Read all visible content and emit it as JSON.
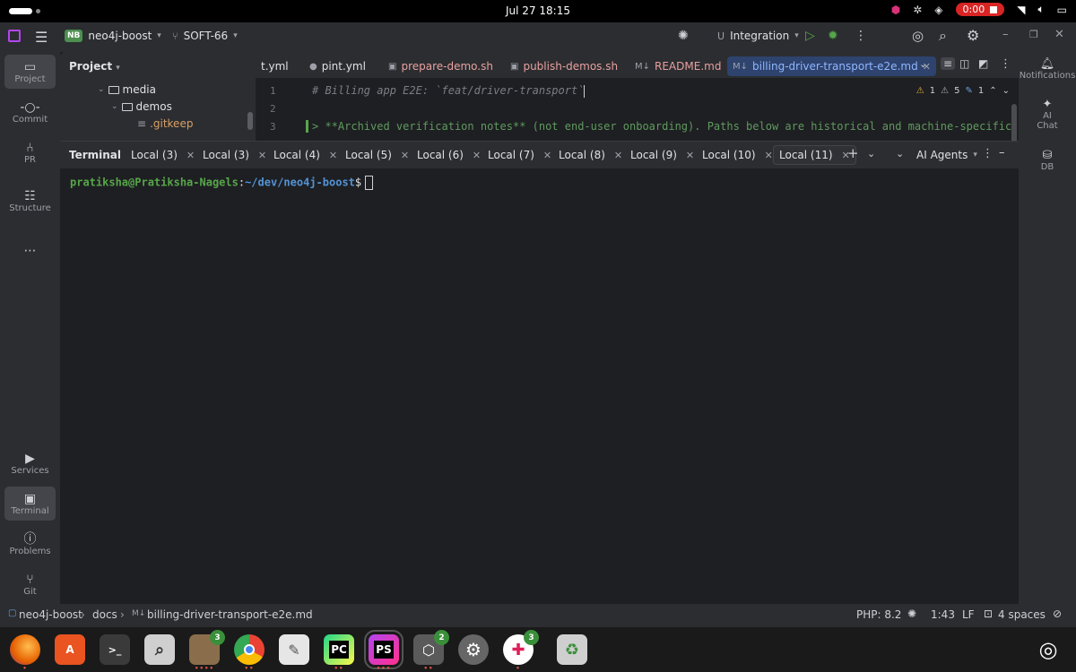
{
  "system": {
    "clock": "Jul 27  18:15",
    "recording": "0:00"
  },
  "toolbar": {
    "project_badge": "NB",
    "project_name": "neo4j-boost",
    "branch": "SOFT-66",
    "run_config": "Integration"
  },
  "left_strip": [
    {
      "label": "Project",
      "icon": "folder-icon"
    },
    {
      "label": "Commit",
      "icon": "commit-icon"
    },
    {
      "label": "PR",
      "icon": "pull-request-icon"
    },
    {
      "label": "Structure",
      "icon": "structure-icon"
    },
    {
      "label": "Services",
      "icon": "services-icon"
    },
    {
      "label": "Terminal",
      "icon": "terminal-icon"
    },
    {
      "label": "Problems",
      "icon": "problems-icon"
    },
    {
      "label": "Git",
      "icon": "git-icon"
    }
  ],
  "right_strip": [
    {
      "label": "Notifications",
      "icon": "bell-icon"
    },
    {
      "label": "AI Chat",
      "icon": "ai-chat-icon"
    },
    {
      "label": "DB",
      "icon": "database-icon"
    }
  ],
  "project_panel": {
    "title": "Project",
    "tree": [
      {
        "label": "media",
        "type": "folder"
      },
      {
        "label": "demos",
        "type": "folder"
      },
      {
        "label": ".gitkeep",
        "type": "file"
      }
    ]
  },
  "editor": {
    "tabs": [
      {
        "label": "t.yml",
        "icon": ""
      },
      {
        "label": "pint.yml",
        "icon": "github-icon"
      },
      {
        "label": "prepare-demo.sh",
        "icon": "shell-icon"
      },
      {
        "label": "publish-demos.sh",
        "icon": "shell-icon"
      },
      {
        "label": "README.md",
        "icon": "markdown-icon"
      },
      {
        "label": "billing-driver-transport-e2e.md",
        "icon": "markdown-icon"
      }
    ],
    "line_numbers": [
      "1",
      "2",
      "3"
    ],
    "lines": [
      "# Billing app E2E: `feat/driver-transport`",
      "",
      "> **Archived verification notes** (not end-user onboarding). Paths below are historical and machine-specific. Pr"
    ],
    "inspections": {
      "warnings": "1",
      "weak_warnings": "5",
      "typos": "1"
    }
  },
  "terminal": {
    "title": "Terminal",
    "tabs": [
      "Local (3)",
      "Local (3)",
      "Local (4)",
      "Local (5)",
      "Local (6)",
      "Local (7)",
      "Local (8)",
      "Local (9)",
      "Local (10)",
      "Local (11)"
    ],
    "ai_agents": "AI Agents",
    "prompt_user": "pratiksha@Pratiksha-Nagels",
    "prompt_sep": ":",
    "prompt_path": "~/dev/neo4j-boost",
    "prompt_symbol": "$"
  },
  "statusbar": {
    "breadcrumb": [
      "neo4j-boost",
      "docs",
      "billing-driver-transport-e2e.md"
    ],
    "php": "PHP: 8.2",
    "position": "1:43",
    "line_sep": "LF",
    "indent": "4 spaces"
  },
  "dock": [
    {
      "name": "firefox",
      "label": "",
      "color": "#e66000"
    },
    {
      "name": "app-center",
      "label": "",
      "color": "#e95420"
    },
    {
      "name": "terminal",
      "label": ">_",
      "color": "#3a3a3a"
    },
    {
      "name": "image-viewer",
      "label": "",
      "color": "#cfcfcf"
    },
    {
      "name": "files",
      "label": "",
      "color": "#8a6e4b",
      "count": "3"
    },
    {
      "name": "chrome",
      "label": "",
      "color": "#4285f4"
    },
    {
      "name": "text-editor",
      "label": "",
      "color": "#e6e6e6"
    },
    {
      "name": "pycharm",
      "label": "PC",
      "color": "#21d789"
    },
    {
      "name": "phpstorm",
      "label": "PS",
      "color": "#b345f1"
    },
    {
      "name": "virtualbox",
      "label": "",
      "color": "#5a5a5a",
      "count": "2"
    },
    {
      "name": "settings",
      "label": "",
      "color": "#666666"
    },
    {
      "name": "slack",
      "label": "",
      "color": "#ffffff",
      "count": "3"
    },
    {
      "name": "trash",
      "label": "",
      "color": "#cfcfcf"
    }
  ]
}
